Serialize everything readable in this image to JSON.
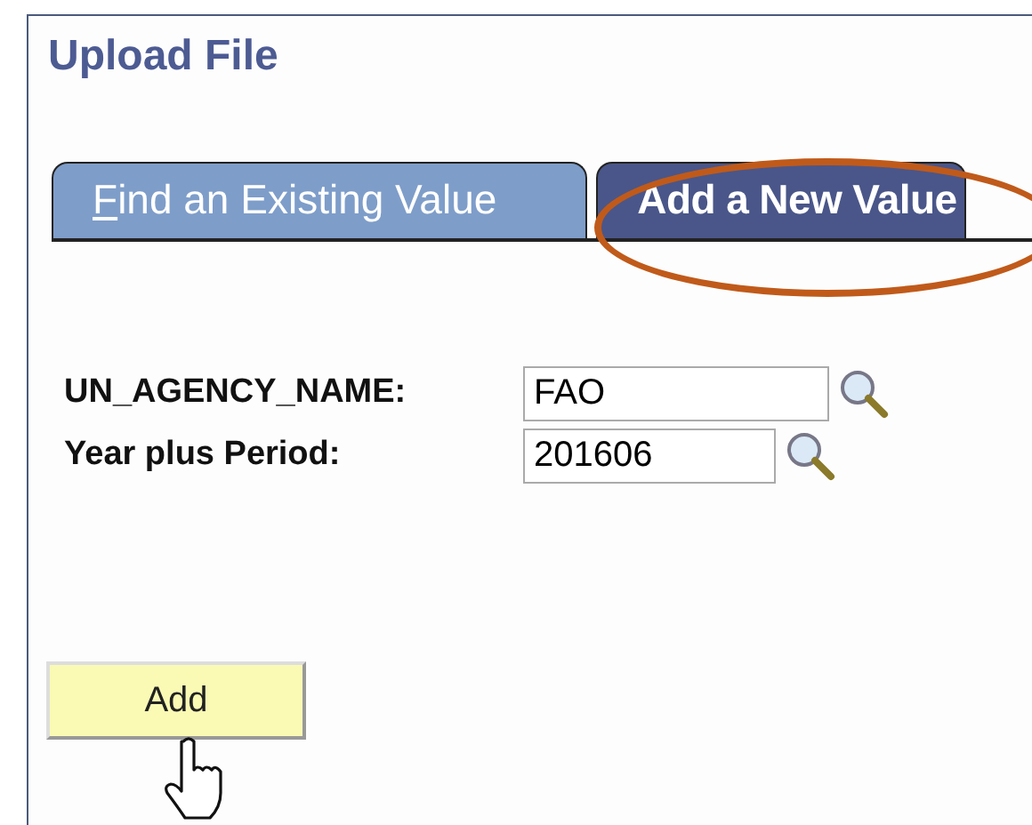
{
  "page": {
    "title": "Upload File"
  },
  "tabs": [
    {
      "label": "Find an Existing Value",
      "first_letter_underlined": true,
      "selected": false,
      "circled": false
    },
    {
      "label": "Add a New Value",
      "selected": true,
      "circled": true
    }
  ],
  "fields": [
    {
      "label": "UN_AGENCY_NAME:",
      "value": "FAO"
    },
    {
      "label": "Year plus Period:",
      "value": "201606"
    }
  ],
  "buttons": [
    {
      "label": "Add",
      "hovered": true
    }
  ]
}
